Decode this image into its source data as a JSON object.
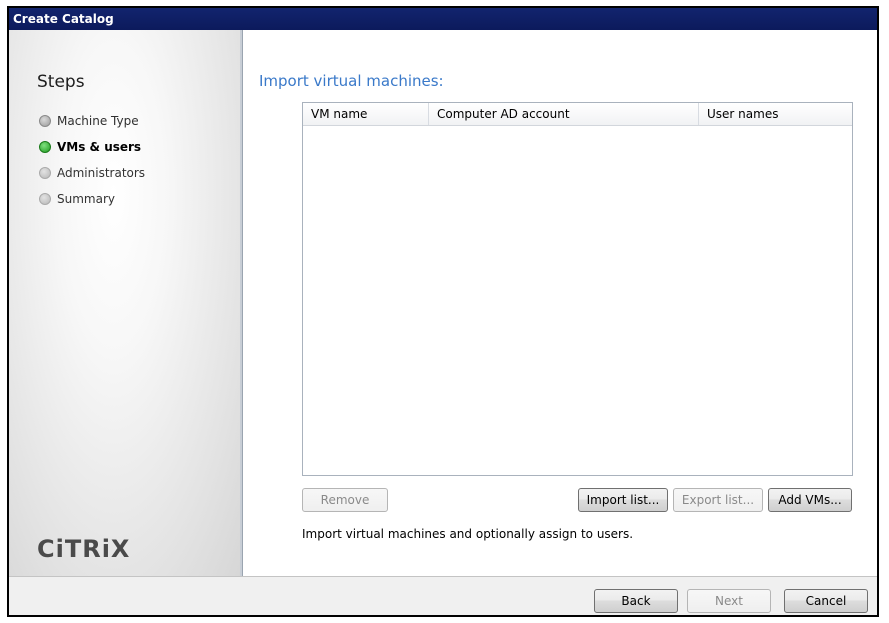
{
  "window": {
    "title": "Create Catalog"
  },
  "sidebar": {
    "title": "Steps",
    "steps": [
      {
        "label": "Machine Type",
        "state": "done"
      },
      {
        "label": "VMs & users",
        "state": "active"
      },
      {
        "label": "Administrators",
        "state": "pending"
      },
      {
        "label": "Summary",
        "state": "pending"
      }
    ],
    "logo": "CiTRiX"
  },
  "main": {
    "heading": "Import virtual machines:",
    "table": {
      "columns": [
        "VM name",
        "Computer AD account",
        "User names"
      ],
      "rows": []
    },
    "buttons": {
      "remove": "Remove",
      "import_list": "Import list...",
      "export_list": "Export list...",
      "add_vms": "Add VMs..."
    },
    "description": "Import virtual machines and optionally assign to users."
  },
  "footer": {
    "back": "Back",
    "next": "Next",
    "cancel": "Cancel"
  },
  "colors": {
    "titlebar": "#0c1a5c",
    "heading": "#3a79c9",
    "active_step": "#1f9a1f"
  }
}
